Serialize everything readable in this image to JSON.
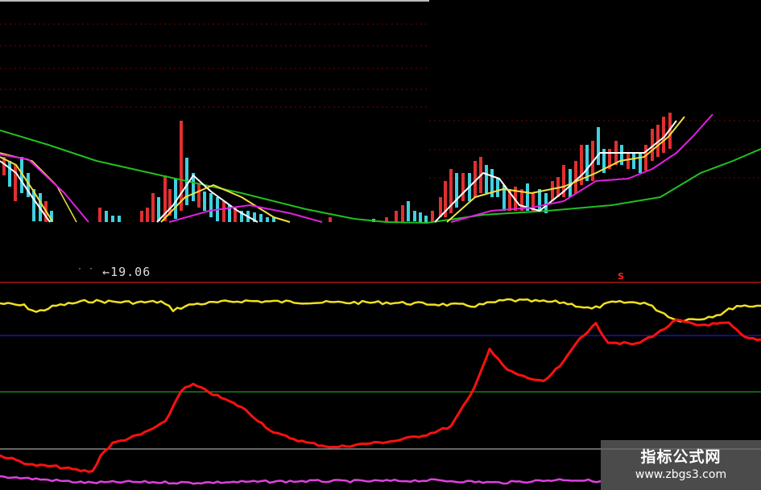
{
  "price_panel": {
    "low_label": "19.06",
    "low_arrow": "←",
    "signal_label": "S"
  },
  "watermark": {
    "title": "指标公式网",
    "url": "www.zbgs3.com"
  },
  "colors": {
    "background": "#000000",
    "candle_up": "#e03030",
    "candle_down": "#40d0e0",
    "ma_white": "#ffffff",
    "ma_yellow": "#f0e040",
    "ma_magenta": "#e020e0",
    "ma_green": "#20c020",
    "indicator_yellow": "#f0e020",
    "indicator_red": "#ff1010",
    "indicator_magenta": "#e040e0",
    "grid": "#7a0000"
  },
  "chart_data": [
    {
      "type": "candlestick",
      "series": [
        {
          "name": "",
          "color": "#ffffff"
        },
        {
          "name": "",
          "color": "#f0e040"
        },
        {
          "name": "",
          "color": "#e020e0"
        },
        {
          "name": "",
          "color": "#20c020"
        }
      ],
      "grid": true,
      "note_label": "19.06"
    },
    {
      "type": "line",
      "series": [
        {
          "name": "",
          "color": "#f0e020"
        },
        {
          "name": "",
          "color": "#ff1010"
        },
        {
          "name": "",
          "color": "#e040e0"
        }
      ],
      "reference_line_colors": [
        "#ff2020",
        "#2020ff",
        "#20c020",
        "#cccccc"
      ],
      "grid": false
    }
  ]
}
